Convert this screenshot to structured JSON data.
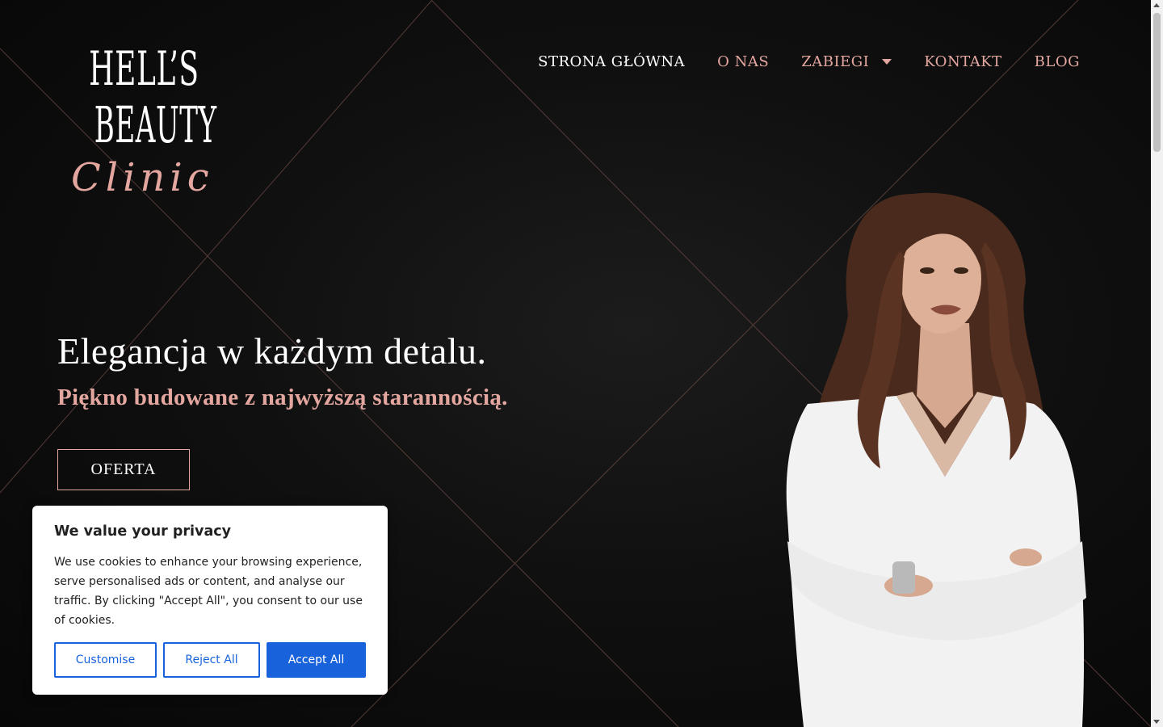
{
  "brand": {
    "line1": "HELL’S",
    "line2": "BEAUTY",
    "line3": "Clinic",
    "accent_color": "#e3a7a0"
  },
  "nav": {
    "items": [
      {
        "label": "STRONA GŁÓWNA",
        "active": true
      },
      {
        "label": "O NAS"
      },
      {
        "label": "ZABIEGI",
        "dropdown": true
      },
      {
        "label": "KONTAKT"
      },
      {
        "label": "BLOG"
      }
    ]
  },
  "hero": {
    "title": "Elegancja w każdym detalu.",
    "subtitle": "Piękno budowane z najwyższą starannością.",
    "cta_label": "OFERTA"
  },
  "cookie": {
    "title": "We value your privacy",
    "text": "We use cookies to enhance your browsing experience, serve personalised ads or content, and analyse our traffic. By clicking \"Accept All\", you consent to our use of cookies.",
    "customise_label": "Customise",
    "reject_label": "Reject All",
    "accept_label": "Accept All",
    "button_color": "#1863dc"
  }
}
